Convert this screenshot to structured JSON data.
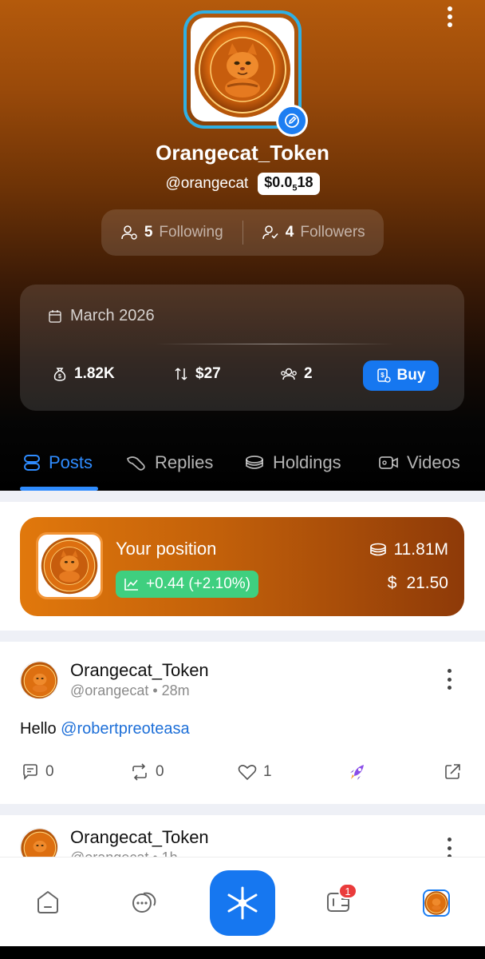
{
  "profile": {
    "name": "Orangecat_Token",
    "handle": "@orangecat",
    "price_main": "$0.0",
    "price_sub": "5",
    "price_tail": "18",
    "coin_text_top": "ORANGECAT TOKEN",
    "coin_text_bottom": "$OCT",
    "coin_text_left": "ONLINE+",
    "coin_text_right": "ICE"
  },
  "follow": {
    "following_count": "5",
    "following_label": "Following",
    "followers_count": "4",
    "followers_label": "Followers"
  },
  "stats": {
    "date": "March 2026",
    "market_cap": "1.82K",
    "volume": "$27",
    "holders": "2",
    "buy_label": "Buy"
  },
  "tabs": [
    {
      "label": "Posts",
      "active": true
    },
    {
      "label": "Replies"
    },
    {
      "label": "Holdings"
    },
    {
      "label": "Videos"
    }
  ],
  "position": {
    "title": "Your position",
    "change": "+0.44 (+2.10%)",
    "amount": "11.81M",
    "usd_symbol": "$",
    "usd_value": "21.50"
  },
  "posts": [
    {
      "author": "Orangecat_Token",
      "handle": "@orangecat",
      "time": "28m",
      "text": "Hello ",
      "mention": "@robertpreoteasa",
      "comments": "0",
      "reposts": "0",
      "likes": "1"
    },
    {
      "author": "Orangecat_Token",
      "handle": "@orangecat",
      "time": "1h"
    }
  ],
  "nav": {
    "notification_count": "1"
  },
  "colors": {
    "accent": "#1677f0",
    "tab_active": "#2f8cff",
    "gain": "#3fcf7f",
    "badge": "#ea3b3b"
  }
}
